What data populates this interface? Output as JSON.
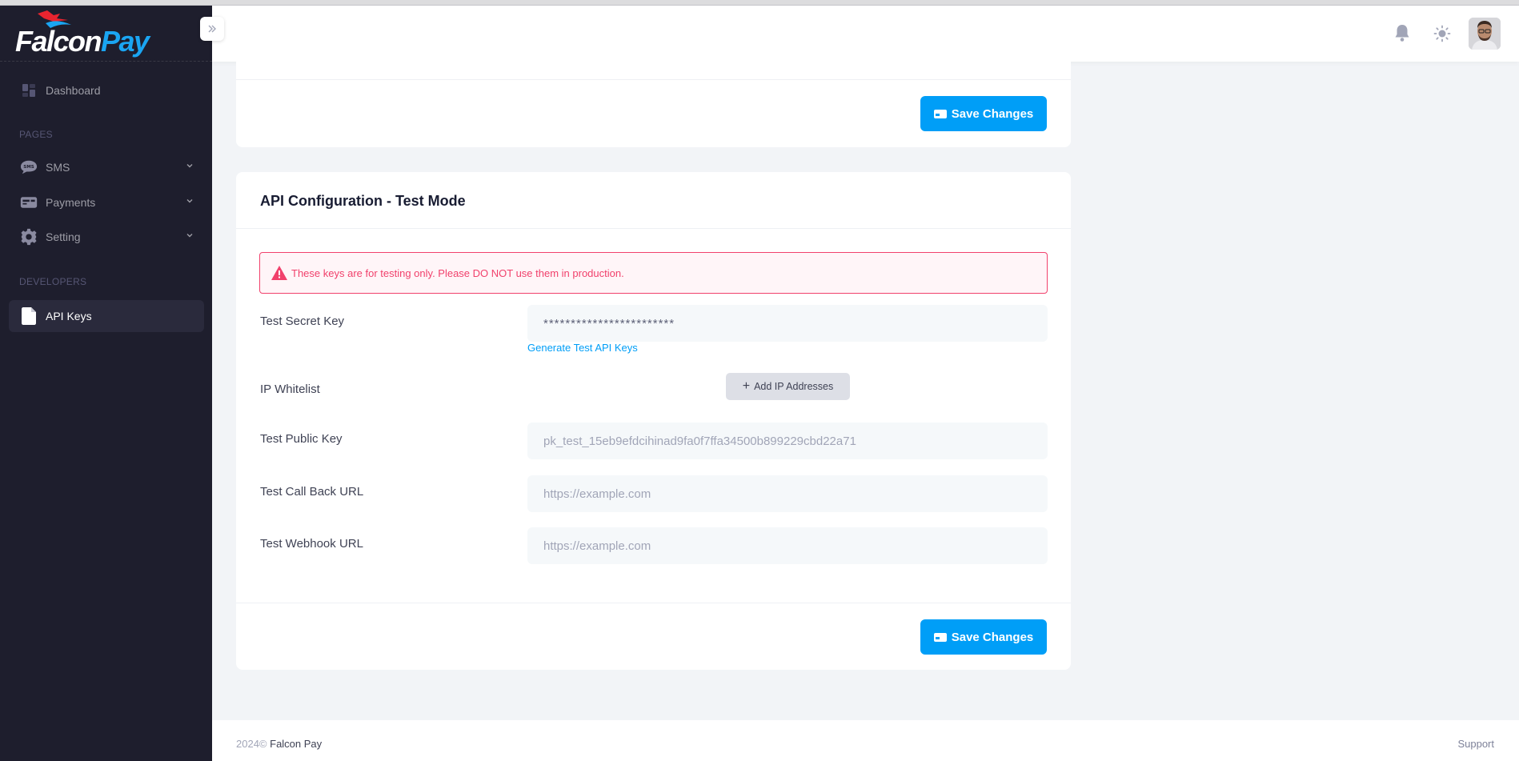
{
  "brand": {
    "name_part1": "Falcon",
    "name_part2": "Pay"
  },
  "sidebar": {
    "dashboard": "Dashboard",
    "section_pages": "PAGES",
    "items": [
      {
        "label": "SMS"
      },
      {
        "label": "Payments"
      },
      {
        "label": "Setting"
      }
    ],
    "section_developers": "DEVELOPERS",
    "api_keys": "API Keys"
  },
  "top_card": {
    "save_label": "Save Changes"
  },
  "api_config": {
    "title": "API Configuration - Test Mode",
    "alert": "These keys are for testing only. Please DO NOT use them in production.",
    "secret_key_label": "Test Secret Key",
    "secret_key_value": "************************",
    "generate_link": "Generate Test API Keys",
    "ip_whitelist_label": "IP Whitelist",
    "add_ip_label": "Add IP Addresses",
    "public_key_label": "Test Public Key",
    "public_key_value": "pk_test_15eb9efdcihinad9fa0f7ffa34500b899229cbd22a71",
    "callback_label": "Test Call Back URL",
    "callback_placeholder": "https://example.com",
    "webhook_label": "Test Webhook URL",
    "webhook_placeholder": "https://example.com",
    "save_label": "Save Changes"
  },
  "footer": {
    "year": "2024©",
    "company": "Falcon Pay",
    "support": "Support"
  },
  "colors": {
    "primary": "#009ef7",
    "sidebar_bg": "#1e1e2d",
    "danger": "#f1416c"
  }
}
